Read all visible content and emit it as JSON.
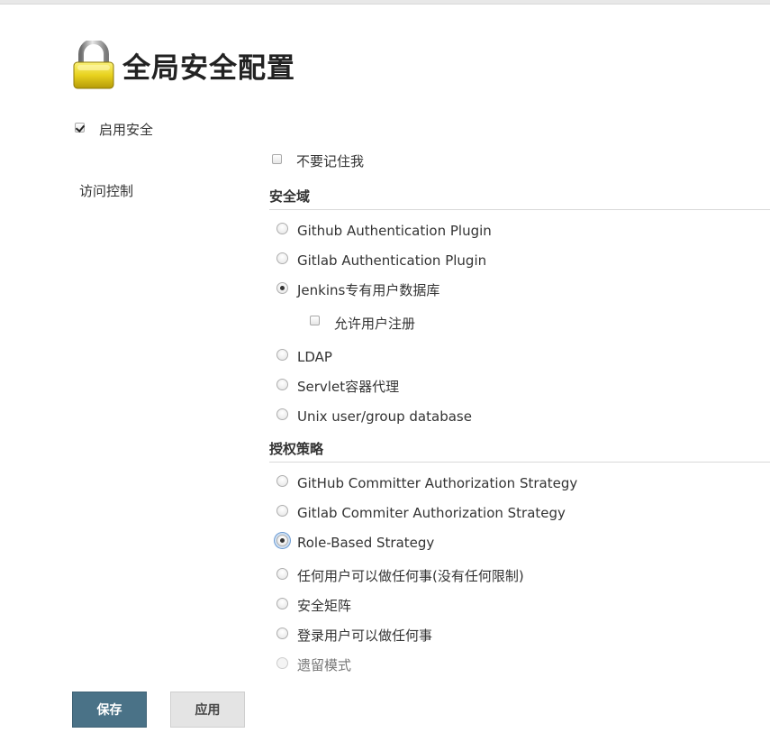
{
  "page": {
    "title": "全局安全配置"
  },
  "enable_security": {
    "label": "启用安全",
    "checked": true
  },
  "access_control": {
    "label": "访问控制",
    "disable_remember_me": {
      "label": "不要记住我",
      "checked": false
    }
  },
  "security_realm": {
    "header": "安全域",
    "options": [
      {
        "label": "Github Authentication Plugin",
        "selected": false
      },
      {
        "label": "Gitlab Authentication Plugin",
        "selected": false
      },
      {
        "label": "Jenkins专有用户数据库",
        "selected": true
      },
      {
        "label": "LDAP",
        "selected": false
      },
      {
        "label": "Servlet容器代理",
        "selected": false
      },
      {
        "label": "Unix user/group database",
        "selected": false
      }
    ],
    "allow_signup": {
      "label": "允许用户注册",
      "checked": false
    }
  },
  "authorization": {
    "header": "授权策略",
    "options": [
      {
        "label": "GitHub Committer Authorization Strategy",
        "selected": false
      },
      {
        "label": "Gitlab Commiter Authorization Strategy",
        "selected": false
      },
      {
        "label": "Role-Based Strategy",
        "selected": true
      },
      {
        "label": "任何用户可以做任何事(没有任何限制)",
        "selected": false
      },
      {
        "label": "安全矩阵",
        "selected": false
      },
      {
        "label": "登录用户可以做任何事",
        "selected": false
      },
      {
        "label": "遗留模式",
        "selected": false,
        "disabled": true
      }
    ]
  },
  "buttons": {
    "save": "保存",
    "apply": "应用"
  },
  "colors": {
    "save_button": "#4a7287",
    "apply_button": "#e4e4e4",
    "lock_body": "#e8d21e"
  },
  "icons": {
    "title": "lock-icon"
  }
}
